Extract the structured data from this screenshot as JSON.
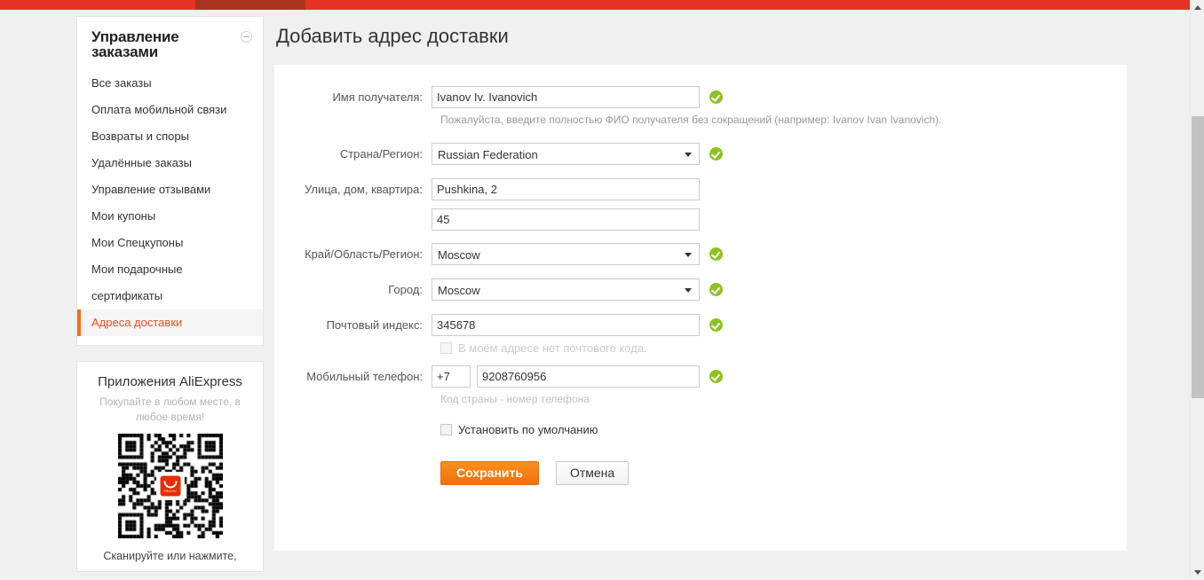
{
  "topbar": {
    "accent_color": "#e43225",
    "segment_color": "#a8331f"
  },
  "sidebar": {
    "header": {
      "title": "Управление заказами",
      "collapse_icon": "minus-circle-icon"
    },
    "items": [
      {
        "label": "Все заказы",
        "active": false
      },
      {
        "label": "Оплата мобильной связи",
        "active": false
      },
      {
        "label": "Возвраты и споры",
        "active": false
      },
      {
        "label": "Удалённые заказы",
        "active": false
      },
      {
        "label": "Управление отзывами",
        "active": false
      },
      {
        "label": "Мои купоны",
        "active": false
      },
      {
        "label": "Мои Спецкупоны",
        "active": false
      },
      {
        "label": "Мои подарочные",
        "active": false
      },
      {
        "label": "сертификаты",
        "active": false
      },
      {
        "label": "Адреса доставки",
        "active": true
      }
    ],
    "active_color": "#f04e23",
    "app_panel": {
      "title": "Приложения AliExpress",
      "subtitle": "Покупайте в любом месте, в любое время!",
      "qr_logo_text": "AliExpress",
      "footer": "Сканируйте или нажмите,"
    }
  },
  "main": {
    "page_title": "Добавить адрес доставки",
    "form": {
      "recipient": {
        "label": "Имя получателя:",
        "value": "Ivanov Iv. Ivanovich",
        "placeholder": "",
        "valid": true,
        "hint": "Пожалуйста, введите полностью ФИО получателя без сокращений (например: Ivanov Ivan Ivanovich)."
      },
      "country": {
        "label": "Страна/Регион:",
        "value": "Russian Federation",
        "valid": true
      },
      "street": {
        "label": "Улица, дом, квартира:",
        "value": "Pushkina, 2",
        "placeholder": ""
      },
      "street2": {
        "label": "",
        "value": "45",
        "placeholder": ""
      },
      "region": {
        "label": "Край/Область/Регион:",
        "value": "Moscow",
        "valid": true
      },
      "city": {
        "label": "Город:",
        "value": "Moscow",
        "valid": true
      },
      "zip": {
        "label": "Почтовый индекс:",
        "value": "345678",
        "placeholder": "",
        "valid": true,
        "no_zip_checkbox": {
          "label": "В моём адресе нет почтового кода.",
          "checked": false,
          "disabled": true
        }
      },
      "phone": {
        "label": "Мобильный телефон:",
        "code": "+7",
        "number": "9208760956",
        "valid": true,
        "hint": "Код страны - номер телефона"
      },
      "default_checkbox": {
        "label": "Установить по умолчанию",
        "checked": false
      },
      "buttons": {
        "save": "Сохранить",
        "cancel": "Отмена",
        "save_color": "#f78017"
      }
    }
  },
  "scrollbar": {
    "up_icon": "chevron-up-icon",
    "down_icon": "chevron-down-icon"
  }
}
